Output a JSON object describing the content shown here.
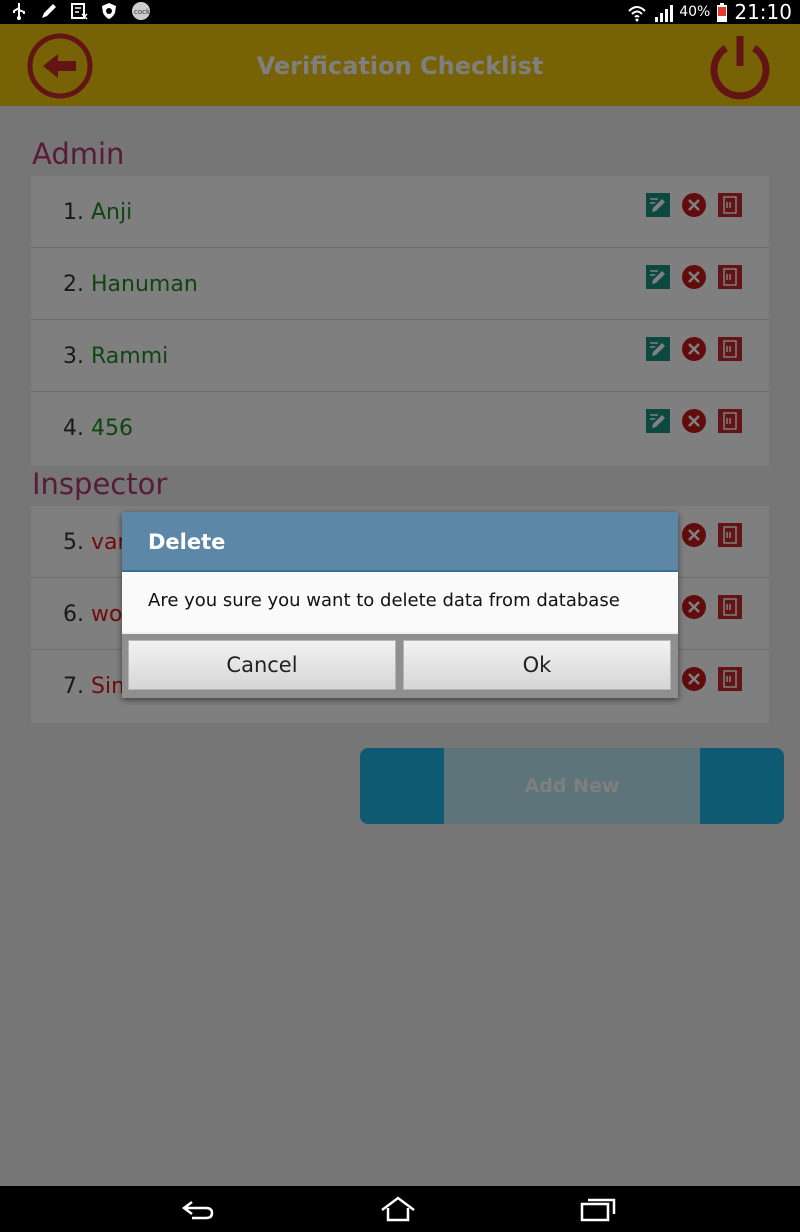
{
  "status_bar": {
    "battery": "40%",
    "time": "21:10",
    "icons": [
      "usb-icon",
      "pencil-icon",
      "calculator-icon",
      "shield-icon",
      "app-icon",
      "wifi-icon",
      "signal-icon",
      "battery-icon"
    ]
  },
  "app_bar": {
    "title": "Verification Checklist",
    "back_icon": "back-arrow-icon",
    "power_icon": "power-icon"
  },
  "sections": [
    {
      "label": "Admin",
      "items": [
        {
          "number": "1.",
          "name": "Anji"
        },
        {
          "number": "2.",
          "name": "Hanuman"
        },
        {
          "number": "3.",
          "name": "Rammi"
        },
        {
          "number": "4.",
          "name": "456"
        }
      ]
    },
    {
      "label": "Inspector",
      "items": [
        {
          "number": "5.",
          "name": "van"
        },
        {
          "number": "6.",
          "name": "wor"
        },
        {
          "number": "7.",
          "name": "Sim"
        }
      ]
    }
  ],
  "row_icons": [
    "edit-icon",
    "delete-icon",
    "document-icon"
  ],
  "add_new_label": "Add New",
  "dialog": {
    "title": "Delete",
    "message": "Are you sure you want to delete data from database",
    "cancel_label": "Cancel",
    "ok_label": "Ok"
  },
  "colors": {
    "app_bar": "#eec60a",
    "section_label": "#b0386a",
    "admin_name": "#1e8a1e",
    "inspector_name": "#e01818",
    "dialog_title": "#5d87a6",
    "add_button": "#1fb5e6"
  }
}
